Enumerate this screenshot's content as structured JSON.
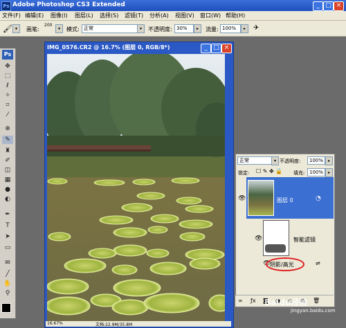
{
  "app": {
    "title": "Adobe Photoshop CS3 Extended",
    "logo_text": "Ps"
  },
  "window_buttons": [
    "_",
    "□",
    "×"
  ],
  "menubar": [
    "文件(F)",
    "编辑(E)",
    "图像(I)",
    "图层(L)",
    "选择(S)",
    "滤镜(T)",
    "分析(A)",
    "视图(V)",
    "窗口(W)",
    "帮助(H)"
  ],
  "options": {
    "brush_label": "画笔:",
    "brush_size": "200",
    "mode_label": "模式:",
    "mode_value": "正常",
    "opacity_label": "不透明度:",
    "opacity_value": "30%",
    "flow_label": "流量:",
    "flow_value": "100%"
  },
  "document": {
    "title": "IMG_0576.CR2 @ 16.7% (图层 0, RGB/8*)",
    "zoom": "16.67%",
    "status": "文档:22.9M/35.8M"
  },
  "layers_panel": {
    "blend_mode": "正常",
    "opacity_label": "不透明度:",
    "opacity_value": "100%",
    "lock_label": "锁定:",
    "fill_label": "填充:",
    "fill_value": "100%",
    "layer_name": "图层 0",
    "filter_label": "智能滤镜",
    "filter_item": "阴影/高光"
  },
  "watermark": {
    "text": "Baidu经验",
    "url": "jingyan.baidu.com"
  },
  "colors": {
    "titlebar": "#2454c9",
    "selected_layer": "#3b6fd1",
    "circle": "#e02020"
  }
}
